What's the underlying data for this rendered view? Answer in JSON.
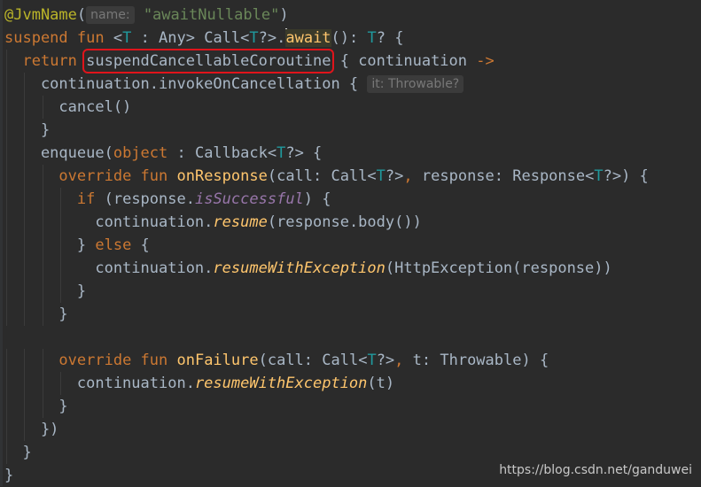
{
  "editor": {
    "lines": [
      {
        "segments": [
          {
            "t": "@JvmName",
            "c": "ann"
          },
          {
            "t": "(",
            "c": ""
          },
          {
            "t": "name:",
            "c": "hint"
          },
          {
            "t": " ",
            "c": ""
          },
          {
            "t": "\"awaitNullable\"",
            "c": "str"
          },
          {
            "t": ")",
            "c": ""
          }
        ]
      },
      {
        "segments": [
          {
            "t": "suspend fun ",
            "c": "kw"
          },
          {
            "t": "<",
            "c": ""
          },
          {
            "t": "T",
            "c": "tp"
          },
          {
            "t": " : Any> Call<",
            "c": ""
          },
          {
            "t": "T",
            "c": "tp"
          },
          {
            "t": "?>.",
            "c": ""
          },
          {
            "t": "await",
            "c": "fn caret-tok",
            "caret": true
          },
          {
            "t": "(): ",
            "c": ""
          },
          {
            "t": "T",
            "c": "tp"
          },
          {
            "t": "? {",
            "c": ""
          }
        ]
      },
      {
        "segments": [
          {
            "t": "  ",
            "c": ""
          },
          {
            "t": "return ",
            "c": "kw"
          },
          {
            "t": "suspendCancellableCoroutine",
            "c": "hl"
          },
          {
            "t": " { continuation ",
            "c": ""
          },
          {
            "t": "->",
            "c": "kw"
          }
        ]
      },
      {
        "segments": [
          {
            "t": "    continuation.invokeOnCancellation { ",
            "c": ""
          },
          {
            "t": "it: Throwable?",
            "c": "hint"
          }
        ]
      },
      {
        "segments": [
          {
            "t": "      cancel()",
            "c": ""
          }
        ]
      },
      {
        "segments": [
          {
            "t": "    }",
            "c": ""
          }
        ]
      },
      {
        "segments": [
          {
            "t": "    enqueue(",
            "c": ""
          },
          {
            "t": "object",
            "c": "kw"
          },
          {
            "t": " : Callback<",
            "c": ""
          },
          {
            "t": "T",
            "c": "tp"
          },
          {
            "t": "?> {",
            "c": ""
          }
        ]
      },
      {
        "segments": [
          {
            "t": "      ",
            "c": ""
          },
          {
            "t": "override fun ",
            "c": "kw"
          },
          {
            "t": "onResponse",
            "c": "fn"
          },
          {
            "t": "(call: Call<",
            "c": ""
          },
          {
            "t": "T",
            "c": "tp"
          },
          {
            "t": "?>",
            "c": ""
          },
          {
            "t": ",",
            "c": "kw"
          },
          {
            "t": " response: Response<",
            "c": ""
          },
          {
            "t": "T",
            "c": "tp"
          },
          {
            "t": "?>) {",
            "c": ""
          }
        ]
      },
      {
        "segments": [
          {
            "t": "        ",
            "c": ""
          },
          {
            "t": "if",
            "c": "kw"
          },
          {
            "t": " (response.",
            "c": ""
          },
          {
            "t": "isSuccessful",
            "c": "prop"
          },
          {
            "t": ") {",
            "c": ""
          }
        ]
      },
      {
        "segments": [
          {
            "t": "          continuation.",
            "c": ""
          },
          {
            "t": "resume",
            "c": "ext"
          },
          {
            "t": "(response.body())",
            "c": ""
          }
        ]
      },
      {
        "segments": [
          {
            "t": "        } ",
            "c": ""
          },
          {
            "t": "else",
            "c": "kw"
          },
          {
            "t": " {",
            "c": ""
          }
        ]
      },
      {
        "segments": [
          {
            "t": "          continuation.",
            "c": ""
          },
          {
            "t": "resumeWithException",
            "c": "ext"
          },
          {
            "t": "(HttpException(response))",
            "c": ""
          }
        ]
      },
      {
        "segments": [
          {
            "t": "        }",
            "c": ""
          }
        ]
      },
      {
        "segments": [
          {
            "t": "      }",
            "c": ""
          }
        ]
      },
      {
        "segments": []
      },
      {
        "segments": [
          {
            "t": "      ",
            "c": ""
          },
          {
            "t": "override fun ",
            "c": "kw"
          },
          {
            "t": "onFailure",
            "c": "fn"
          },
          {
            "t": "(call: Call<",
            "c": ""
          },
          {
            "t": "T",
            "c": "tp"
          },
          {
            "t": "?>",
            "c": ""
          },
          {
            "t": ",",
            "c": "kw"
          },
          {
            "t": " t: Throwable) {",
            "c": ""
          }
        ]
      },
      {
        "segments": [
          {
            "t": "        continuation.",
            "c": ""
          },
          {
            "t": "resumeWithException",
            "c": "ext"
          },
          {
            "t": "(t)",
            "c": ""
          }
        ]
      },
      {
        "segments": [
          {
            "t": "      }",
            "c": ""
          }
        ]
      },
      {
        "segments": [
          {
            "t": "    })",
            "c": ""
          }
        ]
      },
      {
        "segments": [
          {
            "t": "  }",
            "c": ""
          }
        ]
      },
      {
        "segments": [
          {
            "t": "}",
            "c": ""
          }
        ]
      }
    ]
  },
  "watermark": "https://blog.csdn.net/ganduwei"
}
